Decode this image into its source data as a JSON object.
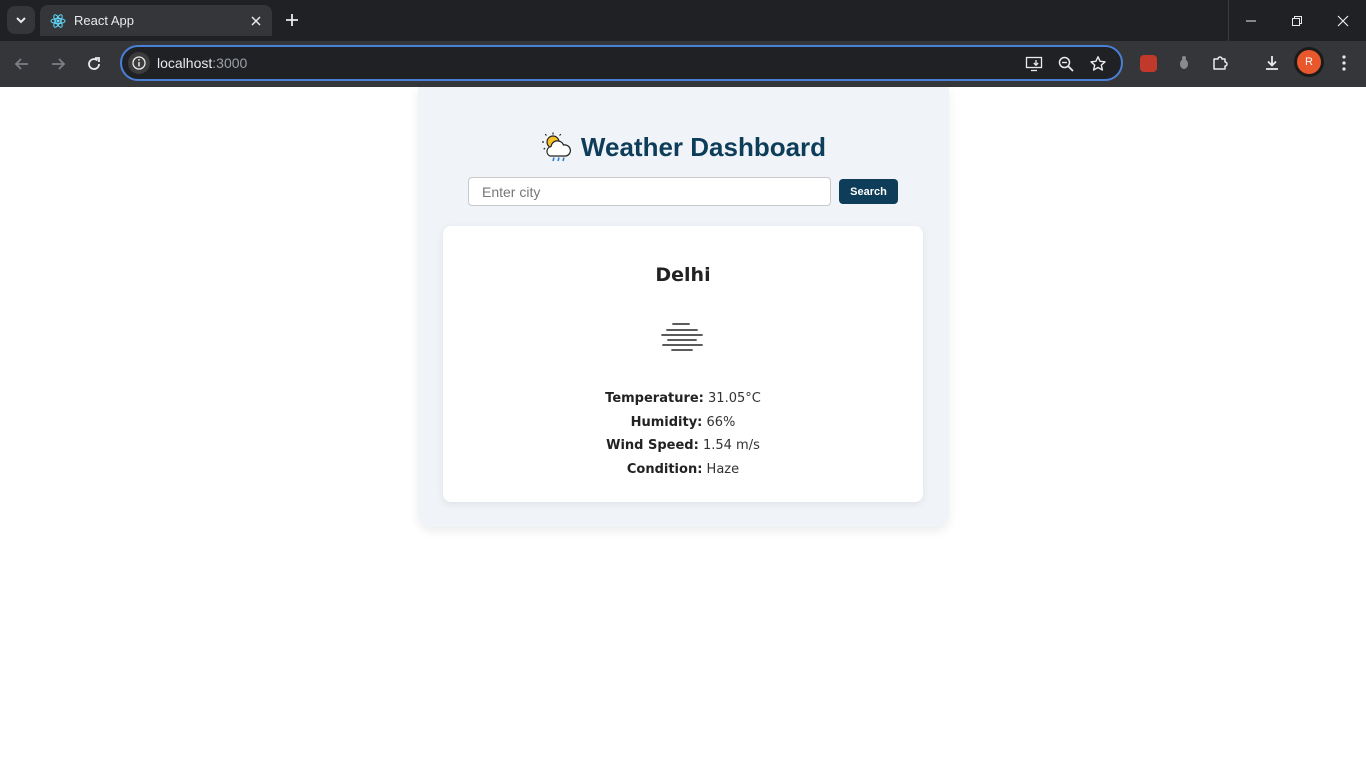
{
  "browser": {
    "tab_title": "React App",
    "url_host": "localhost",
    "url_port": ":3000",
    "profile_initial": "R",
    "accent_color": "#4a7fd6"
  },
  "app": {
    "title": "Weather Dashboard",
    "title_icon": "sun-behind-rain-cloud-emoji",
    "search": {
      "placeholder": "Enter city",
      "value": "",
      "button_label": "Search"
    },
    "brand_color": "#0e3d5a",
    "weather": {
      "city": "Delhi",
      "icon": "haze-icon",
      "stats": [
        {
          "label": "Temperature:",
          "value": "31.05°C"
        },
        {
          "label": "Humidity:",
          "value": "66%"
        },
        {
          "label": "Wind Speed:",
          "value": "1.54 m/s"
        },
        {
          "label": "Condition:",
          "value": "Haze"
        }
      ]
    }
  }
}
